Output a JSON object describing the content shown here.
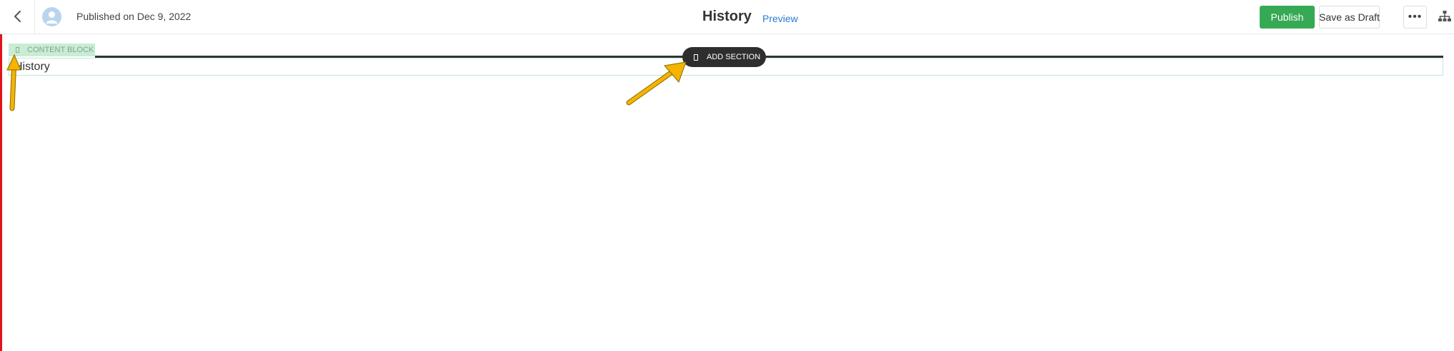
{
  "header": {
    "published_text": "Published on Dec 9, 2022",
    "title": "History",
    "preview_label": "Preview",
    "publish_label": "Publish",
    "save_draft_label": "Save as Draft",
    "more_label": "•••"
  },
  "editor": {
    "content_block_label": "CONTENT BLOCK",
    "add_section_label": "ADD SECTION",
    "content_text": "History"
  },
  "colors": {
    "publish": "#36a954",
    "preview_link": "#2b7bd3",
    "content_block_tag": "#c9ecd5",
    "annotation_arrow": "#f5b400",
    "left_edge": "#e0161b"
  },
  "icons": {
    "back": "chevron-left-icon",
    "avatar": "user-icon",
    "more": "ellipsis-icon",
    "sitemap": "sitemap-icon"
  }
}
